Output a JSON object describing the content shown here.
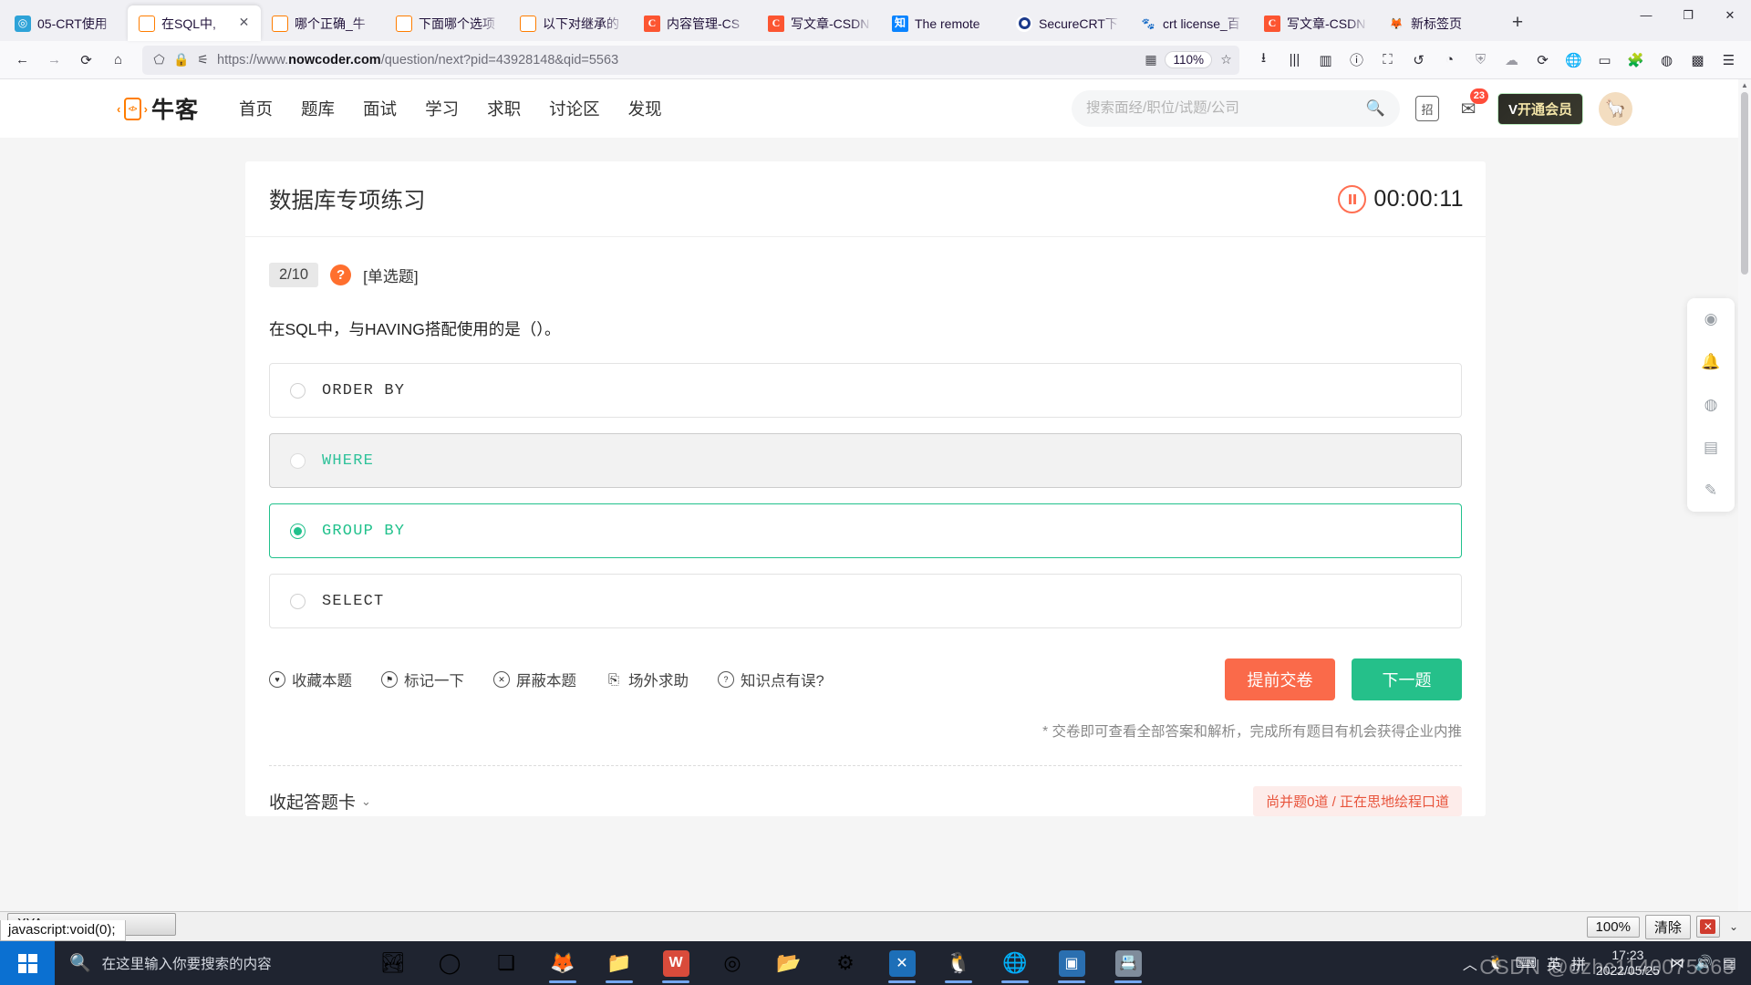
{
  "browser": {
    "tabs": [
      {
        "title": "05-CRT使用",
        "icon": "robot-icon",
        "active": false
      },
      {
        "title": "在SQL中,",
        "icon": "nowcoder-icon",
        "active": true
      },
      {
        "title": "哪个正确_牛",
        "icon": "nowcoder-icon",
        "active": false
      },
      {
        "title": "下面哪个选项",
        "icon": "nowcoder-icon",
        "active": false
      },
      {
        "title": "以下对继承的",
        "icon": "nowcoder-icon",
        "active": false
      },
      {
        "title": "内容管理-CS",
        "icon": "csdn-icon",
        "active": false
      },
      {
        "title": "写文章-CSDN",
        "icon": "csdn-icon",
        "active": false
      },
      {
        "title": "The remote",
        "icon": "zhihu-icon",
        "active": false
      },
      {
        "title": "SecureCRT下",
        "icon": "securecrt-icon",
        "active": false
      },
      {
        "title": "crt license_百",
        "icon": "baidu-icon",
        "active": false
      },
      {
        "title": "写文章-CSDN",
        "icon": "csdn-icon",
        "active": false
      },
      {
        "title": "新标签页",
        "icon": "firefox-icon",
        "active": false
      }
    ],
    "new_tab_label": "+",
    "window_controls": {
      "minimize": "—",
      "maximize": "❐",
      "close": "✕"
    },
    "url_prefix": "https://www.",
    "url_domain": "nowcoder.com",
    "url_path": "/question/next?pid=43928148&qid=5563",
    "zoom_level": "110%",
    "nav": {
      "back": "←",
      "forward": "→",
      "reload": "⟳",
      "home": "⌂"
    }
  },
  "site": {
    "logo_text": "牛客",
    "nav_items": [
      "首页",
      "题库",
      "面试",
      "学习",
      "求职",
      "讨论区",
      "发现"
    ],
    "search_placeholder": "搜索面经/职位/试题/公司",
    "search_value": "",
    "recruit_icon_label": "招",
    "mail_badge": "23",
    "vip_button": "开通会员",
    "vip_prefix": "V"
  },
  "exercise": {
    "title": "数据库专项练习",
    "timer": "00:00:11",
    "question_index": "2/10",
    "question_type": "[单选题]",
    "stem": "在SQL中，与HAVING搭配使用的是（）。",
    "options": [
      {
        "label": "ORDER BY",
        "state": "normal"
      },
      {
        "label": "WHERE",
        "state": "hover"
      },
      {
        "label": "GROUP BY",
        "state": "selected"
      },
      {
        "label": "SELECT",
        "state": "normal"
      }
    ],
    "actions": [
      {
        "label": "收藏本题",
        "icon": "heart-icon"
      },
      {
        "label": "标记一下",
        "icon": "flag-icon"
      },
      {
        "label": "屏蔽本题",
        "icon": "block-icon"
      },
      {
        "label": "场外求助",
        "icon": "help-outside-icon"
      },
      {
        "label": "知识点有误?",
        "icon": "question-icon"
      }
    ],
    "submit_button": "提前交卷",
    "next_button": "下一题",
    "note": "* 交卷即可查看全部答案和解析，完成所有题目有机会获得企业内推",
    "collapse_label": "收起答题卡",
    "bottom_hint": "尚并题0道 / 正在思地绘程口道",
    "colors": {
      "accent_green": "#21c18c",
      "accent_orange": "#fa6a4a",
      "brand_orange": "#ff7d00"
    }
  },
  "dock": [
    {
      "name": "weibo-icon",
      "glyph": "◉"
    },
    {
      "name": "bell-icon",
      "glyph": "🔔"
    },
    {
      "name": "wechat-icon",
      "glyph": "◍"
    },
    {
      "name": "book-icon",
      "glyph": "▤"
    },
    {
      "name": "feedback-icon",
      "glyph": "✎"
    }
  ],
  "statusbar": {
    "link_preview": "javascript:void(0);",
    "download_item": "XYArea.csv",
    "find_zoom": "100%",
    "find_clear": "清除",
    "find_close": "✕",
    "find_chevron": "⌄"
  },
  "taskbar": {
    "search_placeholder": "在这里输入你要搜索的内容",
    "items": [
      {
        "name": "photos-icon",
        "glyph": "🏞"
      },
      {
        "name": "cortana-icon",
        "glyph": "◯"
      },
      {
        "name": "taskview-icon",
        "glyph": "❏"
      },
      {
        "name": "firefox-icon",
        "glyph": "🦊"
      },
      {
        "name": "explorer-icon",
        "glyph": "📁"
      },
      {
        "name": "wps-icon",
        "glyph": "W"
      },
      {
        "name": "edge-legacy-icon",
        "glyph": "◎"
      },
      {
        "name": "folder-icon",
        "glyph": "📂"
      },
      {
        "name": "settings-gear-icon",
        "glyph": "⚙"
      },
      {
        "name": "vscode-icon",
        "glyph": "✕"
      },
      {
        "name": "qq-icon",
        "glyph": "🐧"
      },
      {
        "name": "edge-icon",
        "glyph": "🌐"
      },
      {
        "name": "securecrt-icon",
        "glyph": "▣"
      },
      {
        "name": "snip-icon",
        "glyph": "📇"
      }
    ],
    "tray": {
      "chevron": "︿",
      "qq": "🐧",
      "keyboard": "⌨",
      "ime_mode": "英",
      "ime_pinyin": "拼",
      "time": "17:23",
      "date": "2022/05/25",
      "network": "⋈",
      "volume": "🔊",
      "action_center": "▤"
    },
    "watermark": "CSDN @ozhc1140075563"
  }
}
